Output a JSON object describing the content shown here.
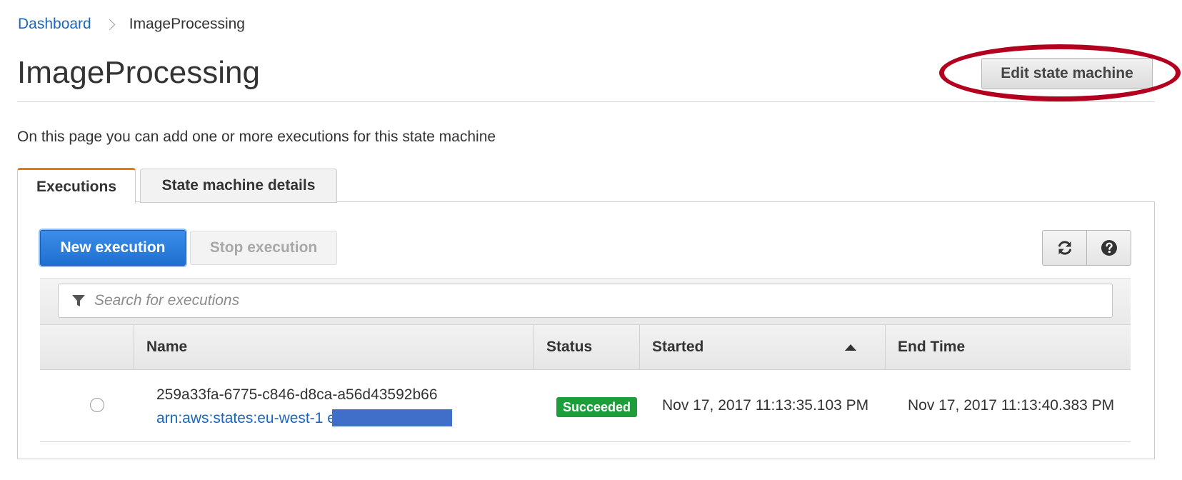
{
  "breadcrumb": {
    "root": "Dashboard",
    "current": "ImageProcessing"
  },
  "page": {
    "title": "ImageProcessing",
    "edit_button": "Edit state machine",
    "intro": "On this page you can add one or more executions for this state machine"
  },
  "tabs": [
    {
      "label": "Executions",
      "active": true
    },
    {
      "label": "State machine details",
      "active": false
    }
  ],
  "toolbar": {
    "new_execution": "New execution",
    "stop_execution": "Stop execution",
    "refresh_icon": "refresh-icon",
    "help_icon": "help-icon"
  },
  "search": {
    "placeholder": "Search for executions",
    "icon": "filter-icon"
  },
  "table": {
    "columns": [
      "Name",
      "Status",
      "Started",
      "End Time"
    ],
    "sort_column": "Started",
    "sort_direction": "ascending",
    "rows": [
      {
        "name": "259a33fa-6775-c846-d8ca-a56d43592b66",
        "arn": "arn:aws:states:eu-west-1                        execution...",
        "status": "Succeeded",
        "started": "Nov 17, 2017 11:13:35.103 PM",
        "end_time": "Nov 17, 2017 11:13:40.383 PM"
      }
    ]
  },
  "colors": {
    "link": "#1a66c0",
    "primary_button": "#1f6fd1",
    "active_tab_accent": "#e47911",
    "success_badge": "#1d9e3b",
    "highlight_annotation": "#b3001e",
    "redaction": "#3f6fc8"
  }
}
